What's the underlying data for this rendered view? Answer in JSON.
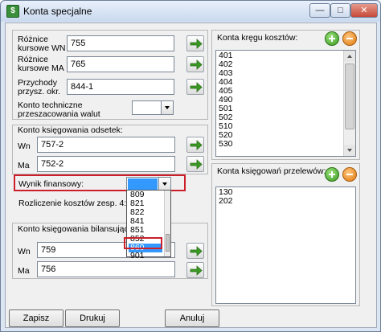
{
  "window": {
    "title": "Konta specjalne",
    "app_icon": "ledger-icon",
    "controls": {
      "minimize": "—",
      "maximize": "□",
      "close": "✕"
    }
  },
  "currency": {
    "wn_label": "Różnice\nkursowe WN",
    "wn_value": "755",
    "ma_label": "Różnice\nkursowe MA",
    "ma_value": "765",
    "income_label": "Przychody\nprzysz. okr.",
    "income_value": "844-1",
    "tech_label": "Konto techniczne\nprzeszacowania walut",
    "tech_value": ""
  },
  "interest": {
    "group_title": "Konto księgowania odsetek:",
    "wn_label": "Wn",
    "wn_value": "757-2",
    "ma_label": "Ma",
    "ma_value": "752-2"
  },
  "result": {
    "label": "Wynik finansowy:",
    "cost_label": "Rozliczenie kosztów zesp. 4:",
    "dropdown_options": [
      "809",
      "821",
      "822",
      "841",
      "851",
      "852",
      "860",
      "901"
    ],
    "dropdown_selected": "860"
  },
  "balance": {
    "group_title": "Konto księgowania bilansującego o",
    "wn_label": "Wn",
    "wn_value": "759",
    "ma_label": "Ma",
    "ma_value": "756"
  },
  "cost_circle": {
    "group_title": "Konta kręgu kosztów:",
    "items": [
      "401",
      "402",
      "403",
      "404",
      "405",
      "490",
      "501",
      "502",
      "510",
      "520",
      "530"
    ]
  },
  "transfer": {
    "group_title": "Konta księgowań przelewów:",
    "items": [
      "130",
      "202"
    ]
  },
  "buttons": {
    "save": "Zapisz",
    "print": "Drukuj",
    "cancel": "Anuluj"
  },
  "colors": {
    "accent_selection": "#3399ff",
    "highlight_red": "#cc1f2a",
    "go_arrow": "#3a9a22"
  }
}
